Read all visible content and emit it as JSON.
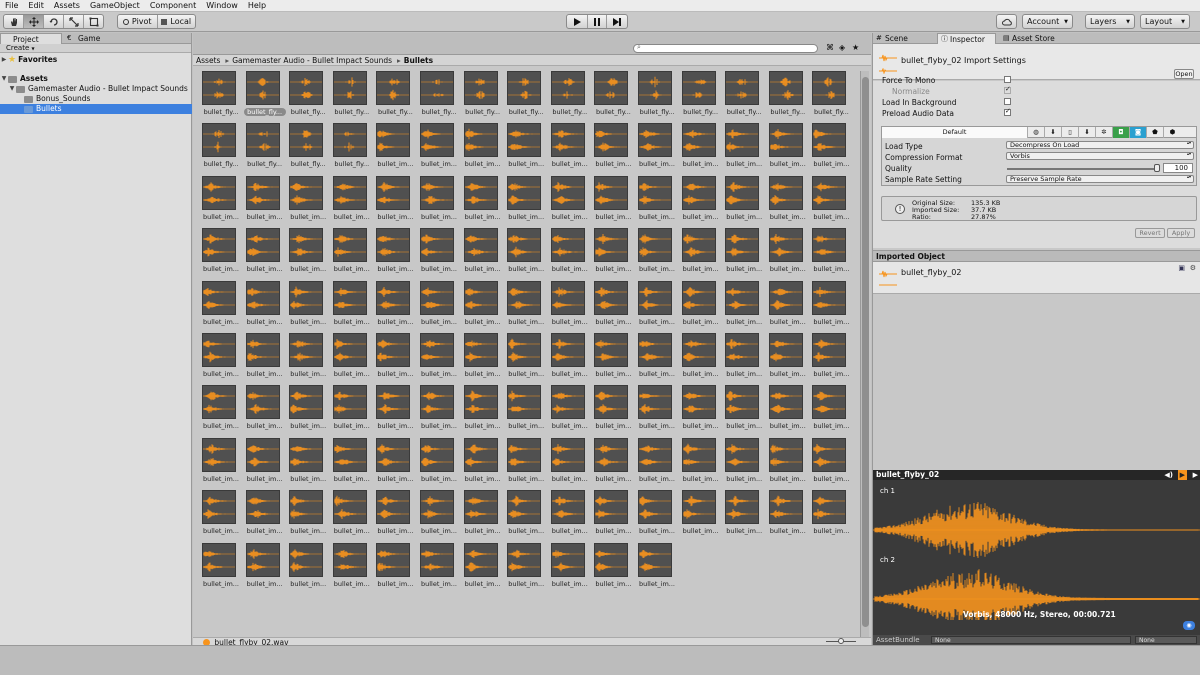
{
  "menu": [
    "File",
    "Edit",
    "Assets",
    "GameObject",
    "Component",
    "Window",
    "Help"
  ],
  "toolbar": {
    "pivot_label": "Pivot",
    "local_label": "Local",
    "account_label": "Account",
    "layers_label": "Layers",
    "layout_label": "Layout"
  },
  "project": {
    "tab_project": "Project",
    "tab_game": "Game",
    "create_label": "Create",
    "favorites": "Favorites",
    "assets": "Assets",
    "pack_folder": "Gamemaster Audio - Bullet Impact Sounds",
    "bonus_folder": "Bonus_Sounds",
    "bullets_folder": "Bullets"
  },
  "browser": {
    "breadcrumb": [
      "Assets",
      "Gamemaster Audio - Bullet Impact Sounds",
      "Bullets"
    ],
    "status_file": "bullet_flyby_02.wav",
    "selected_label": "bullet_fly...",
    "flyby_label": "bullet_fly...",
    "impact_label": "bullet_im...",
    "flyby_count": 19,
    "impact_count": 127,
    "selected_index": 1
  },
  "colors": {
    "waveform": "#f7941d",
    "thumb_bg": "#505050",
    "selection": "#3d80df",
    "preview_bg": "#3a3a3a"
  },
  "inspector": {
    "tab_scene": "Scene",
    "tab_inspector": "Inspector",
    "tab_asset_store": "Asset Store",
    "title": "bullet_flyby_02 Import Settings",
    "open_label": "Open",
    "force_to_mono": "Force To Mono",
    "normalize": "Normalize",
    "load_in_background": "Load In Background",
    "preload_audio_data": "Preload Audio Data",
    "force_to_mono_checked": false,
    "normalize_checked": true,
    "load_in_background_checked": false,
    "preload_audio_data_checked": true,
    "platform_default": "Default",
    "load_type_label": "Load Type",
    "load_type_value": "Decompress On Load",
    "compression_label": "Compression Format",
    "compression_value": "Vorbis",
    "quality_label": "Quality",
    "quality_value": "100",
    "sample_rate_label": "Sample Rate Setting",
    "sample_rate_value": "Preserve Sample Rate",
    "original_size_label": "Original Size:",
    "original_size_value": "135.3 KB",
    "imported_size_label": "Imported Size:",
    "imported_size_value": "37.7 KB",
    "ratio_label": "Ratio:",
    "ratio_value": "27.87%",
    "revert_label": "Revert",
    "apply_label": "Apply",
    "imported_object_header": "Imported Object",
    "imported_object_name": "bullet_flyby_02"
  },
  "preview": {
    "title": "bullet_flyby_02",
    "ch1": "ch 1",
    "ch2": "ch 2",
    "info": "Vorbis, 48000 Hz, Stereo, 00:00.721",
    "asset_bundle_label": "AssetBundle",
    "bundle_value": "None",
    "variant_value": "None"
  }
}
